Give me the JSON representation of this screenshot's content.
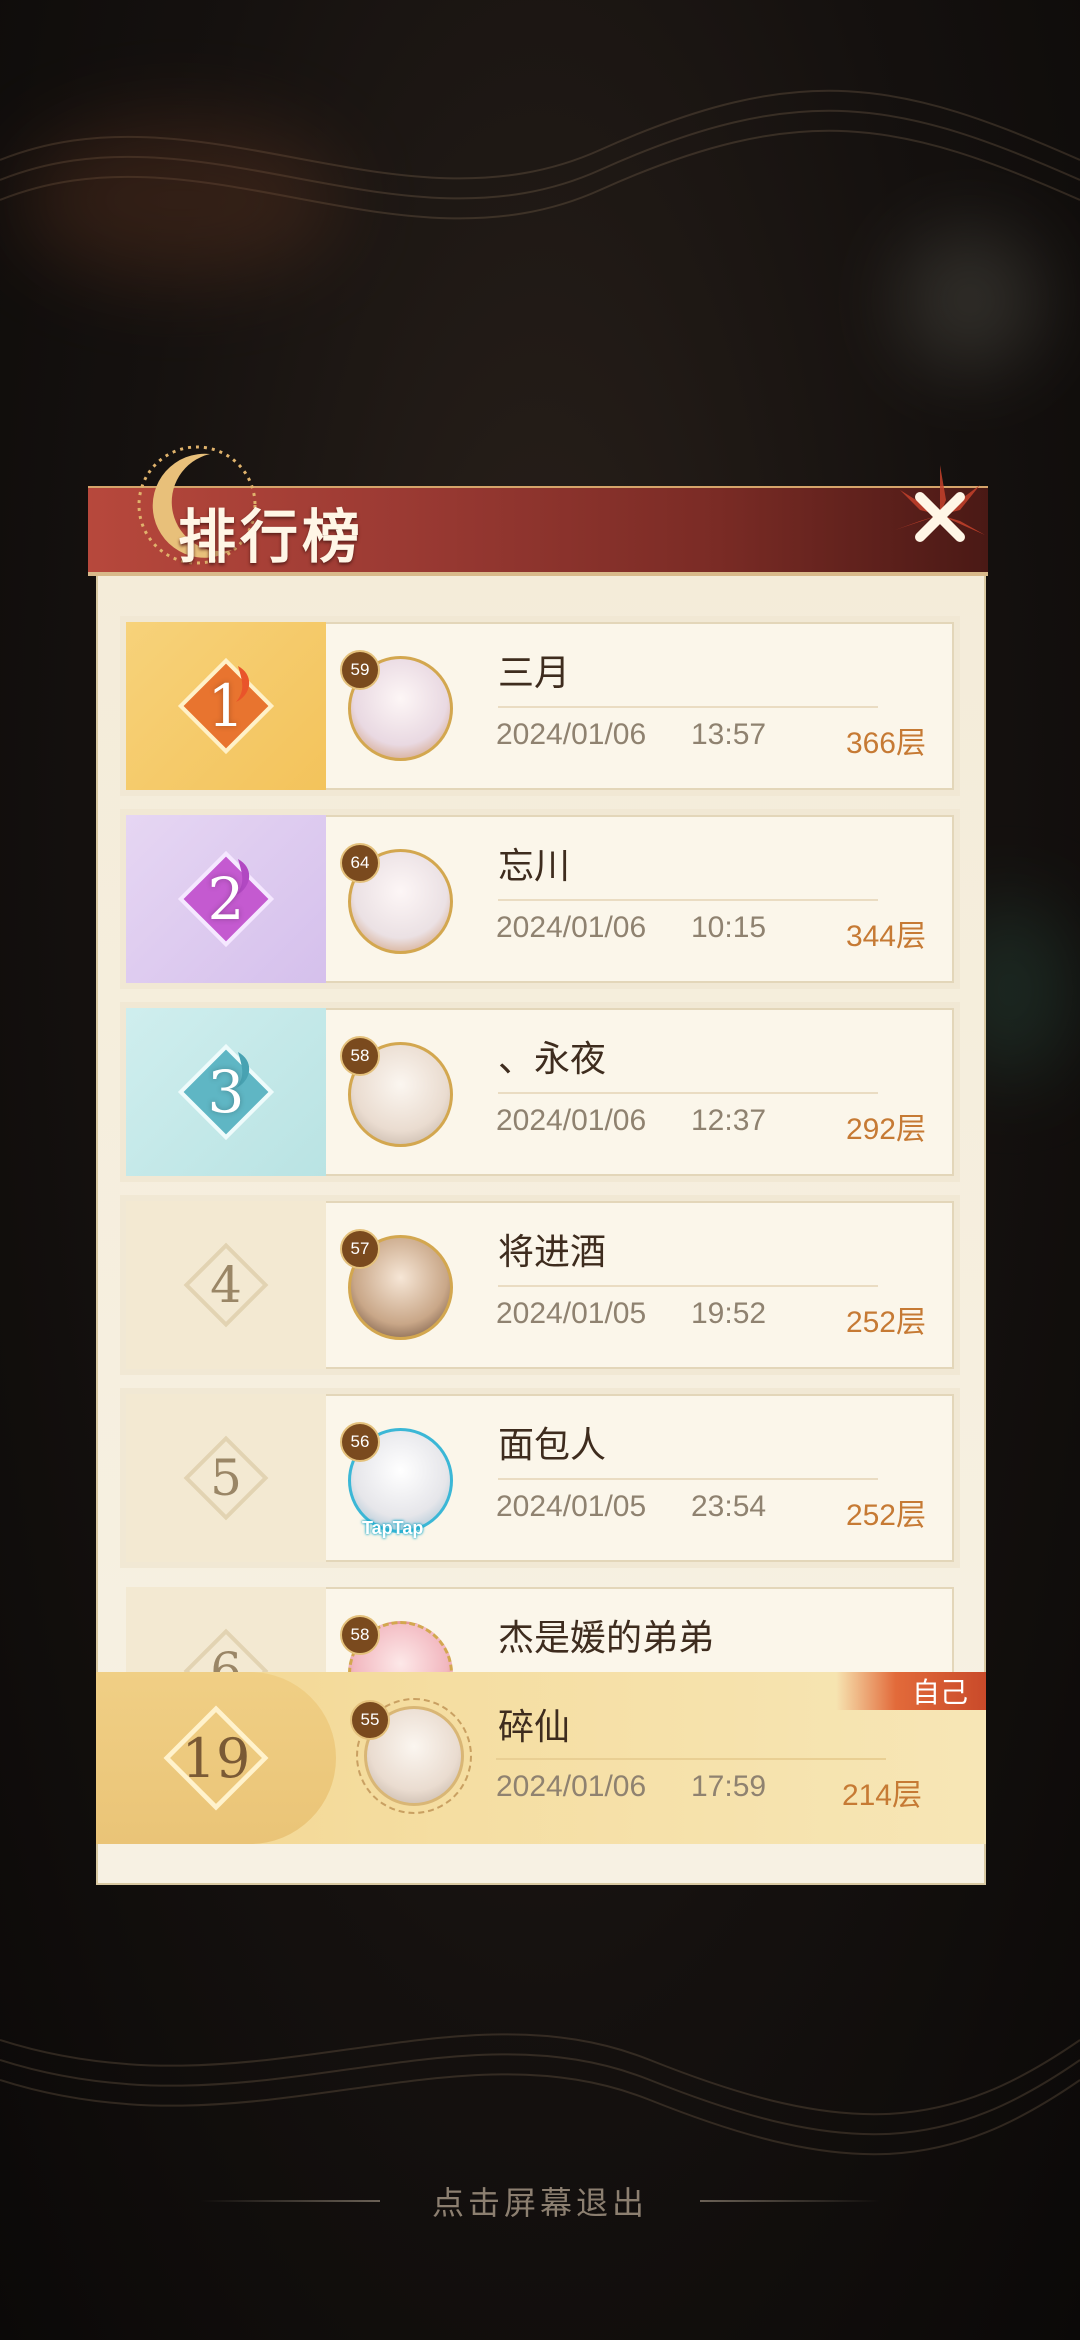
{
  "leaderboard": {
    "title": "排行榜",
    "rows": [
      {
        "rank": "1",
        "level": "59",
        "name": "三月",
        "date": "2024/01/06",
        "time": "13:57",
        "floor": "366层",
        "color": "#f0a23a"
      },
      {
        "rank": "2",
        "level": "64",
        "name": "忘川",
        "date": "2024/01/06",
        "time": "10:15",
        "floor": "344层",
        "color": "#c45ad0"
      },
      {
        "rank": "3",
        "level": "58",
        "name": "、永夜",
        "date": "2024/01/06",
        "time": "12:37",
        "floor": "292层",
        "color": "#5fb6c4"
      },
      {
        "rank": "4",
        "level": "57",
        "name": "将进酒",
        "date": "2024/01/05",
        "time": "19:52",
        "floor": "252层"
      },
      {
        "rank": "5",
        "level": "56",
        "name": "面包人",
        "date": "2024/01/05",
        "time": "23:54",
        "floor": "252层",
        "badge": "TapTap"
      },
      {
        "rank": "6",
        "level": "58",
        "name": "杰是媛的弟弟"
      }
    ],
    "self": {
      "tag": "自己",
      "rank": "19",
      "level": "55",
      "name": "碎仙",
      "date": "2024/01/06",
      "time": "17:59",
      "floor": "214层"
    }
  },
  "footer": {
    "hint": "点击屏幕退出"
  },
  "colors": {
    "header": "#9b3a33",
    "floor_text": "#c67a34",
    "panel": "#f4ecd9"
  }
}
